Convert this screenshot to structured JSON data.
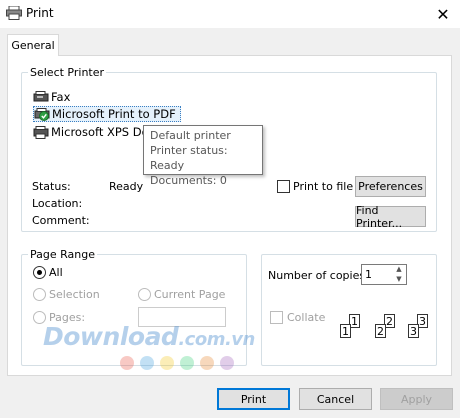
{
  "window": {
    "title": "Print",
    "close_glyph": "✕"
  },
  "tabs": [
    {
      "label": "General",
      "active": true
    }
  ],
  "select_printer": {
    "label": "Select Printer",
    "printers": [
      {
        "name": "Fax",
        "icon": "fax-printer-icon",
        "selected": false
      },
      {
        "name": "Microsoft Print to PDF",
        "icon": "default-printer-icon",
        "selected": true
      },
      {
        "name": "Microsoft XPS Do",
        "icon": "printer-icon",
        "selected": false
      }
    ],
    "tooltip": {
      "line1": "Default printer",
      "line2": "Printer status: Ready",
      "line3": "Documents: 0"
    },
    "status_label": "Status:",
    "status_value": "Ready",
    "location_label": "Location:",
    "comment_label": "Comment:",
    "print_to_file_label": "Print to file",
    "print_to_file_checked": false,
    "preferences_button": "Preferences",
    "find_printer_button": "Find Printer..."
  },
  "page_range": {
    "label": "Page Range",
    "all_label": "All",
    "selection_label": "Selection",
    "current_page_label": "Current Page",
    "pages_label": "Pages:",
    "pages_value": "",
    "selected_option": "All"
  },
  "copies": {
    "number_label": "Number of copies:",
    "number_value": "1",
    "collate_label": "Collate",
    "collate_checked": false,
    "collate_pages": [
      "1",
      "1",
      "2",
      "2",
      "3",
      "3"
    ]
  },
  "watermark": {
    "text": "Download",
    "suffix": ".com.vn",
    "dot_colors": [
      "#e74c3c",
      "#3498db",
      "#f1c40f",
      "#2ecc71",
      "#e67e22",
      "#9b59b6"
    ]
  },
  "footer": {
    "print_button": "Print",
    "cancel_button": "Cancel",
    "apply_button": "Apply"
  }
}
